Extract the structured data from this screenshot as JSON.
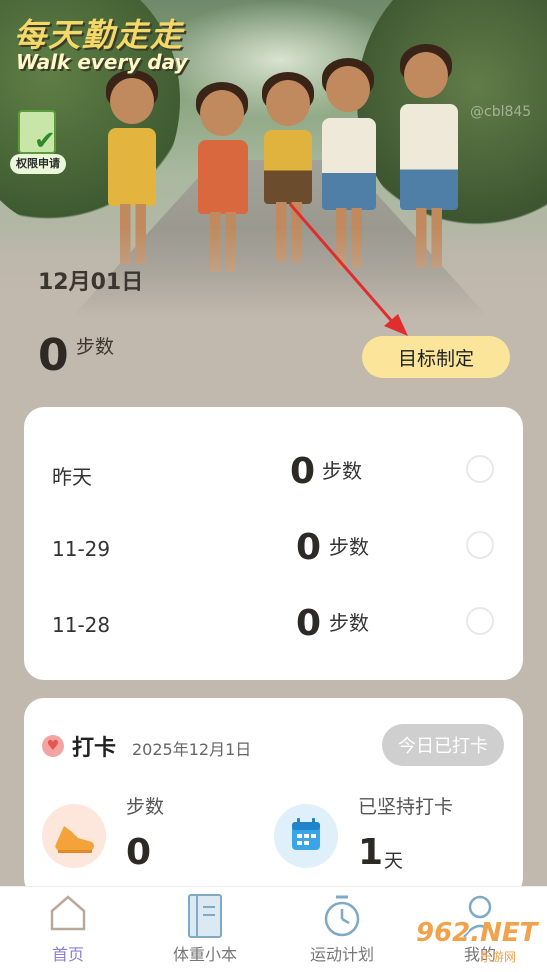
{
  "hero": {
    "title": "每天勤走走",
    "subtitle": "Walk every day",
    "permission_label": "权限申请",
    "watermark_id": "@cbl845",
    "date": "12月01日"
  },
  "today": {
    "steps": "0",
    "unit": "步数",
    "goal_button": "目标制定"
  },
  "history": [
    {
      "date": "昨天",
      "steps": "0",
      "unit": "步数"
    },
    {
      "date": "11-29",
      "steps": "0",
      "unit": "步数"
    },
    {
      "date": "11-28",
      "steps": "0",
      "unit": "步数"
    }
  ],
  "checkin": {
    "title": "打卡",
    "date": "2025年12月1日",
    "button": "今日已打卡",
    "steps_label": "步数",
    "steps_value": "0",
    "streak_label": "已坚持打卡",
    "streak_value": "1",
    "streak_unit": "天"
  },
  "nav": {
    "items": [
      {
        "label": "首页",
        "icon": "home-icon",
        "active": true
      },
      {
        "label": "体重小本",
        "icon": "notebook-icon",
        "active": false
      },
      {
        "label": "运动计划",
        "icon": "stopwatch-icon",
        "active": false
      },
      {
        "label": "我的",
        "icon": "profile-icon",
        "active": false
      }
    ]
  },
  "watermark": {
    "brand": "962.NET",
    "sub": "乐游网"
  },
  "colors": {
    "background": "#c2b9ae",
    "goal_button": "#fbe59a",
    "active_nav": "#8a7fd2",
    "checked_button": "#cfcfcf"
  }
}
